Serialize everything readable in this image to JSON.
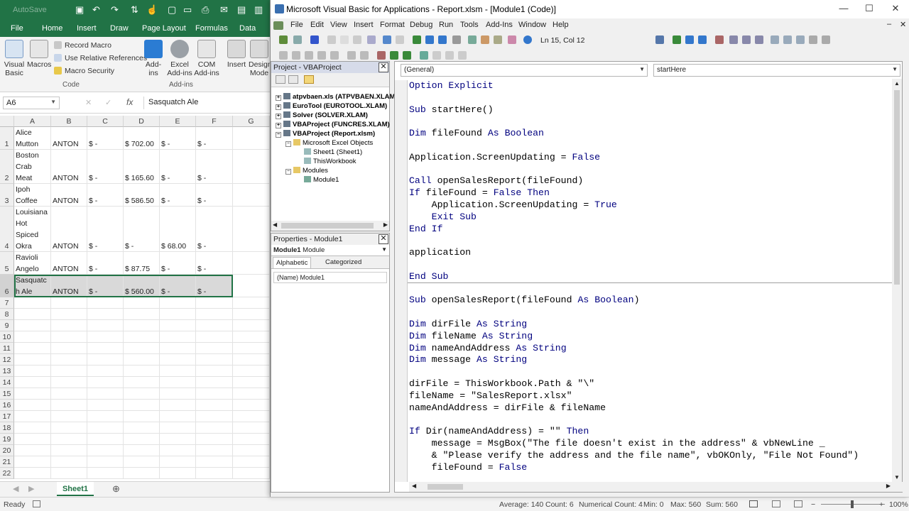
{
  "excel": {
    "autosave": "AutoSave",
    "tabs": [
      "File",
      "Home",
      "Insert",
      "Draw",
      "Page Layout",
      "Formulas",
      "Data"
    ],
    "ribbon": {
      "visual_basic": "Visual Basic",
      "macros": "Macros",
      "record_macro": "Record Macro",
      "relative_refs": "Use Relative References",
      "macro_security": "Macro Security",
      "group_code": "Code",
      "addins": "Add-ins",
      "excel_addins": "Excel Add-ins",
      "com_addins": "COM Add-ins",
      "group_addins": "Add-ins",
      "insert": "Insert",
      "design_mode": "Design Mode"
    },
    "name_box": "A6",
    "fx": "fx",
    "formula_value": "Sasquatch Ale",
    "columns": [
      "A",
      "B",
      "C",
      "D",
      "E",
      "F",
      "G"
    ],
    "rows": [
      {
        "n": "1",
        "a": [
          "Alice",
          "Mutton"
        ],
        "b": "ANTON",
        "c": "$      -",
        "d": "$ 702.00",
        "e": "$      -",
        "f": "$      -"
      },
      {
        "n": "2",
        "a": [
          "Boston",
          "Crab",
          "Meat"
        ],
        "b": "ANTON",
        "c": "$      -",
        "d": "$ 165.60",
        "e": "$      -",
        "f": "$      -"
      },
      {
        "n": "3",
        "a": [
          "Ipoh",
          "Coffee"
        ],
        "b": "ANTON",
        "c": "$      -",
        "d": "$ 586.50",
        "e": "$      -",
        "f": "$      -"
      },
      {
        "n": "4",
        "a": [
          "Louisiana",
          "Hot",
          "Spiced",
          "Okra"
        ],
        "b": "ANTON",
        "c": "$      -",
        "d": "$      -",
        "e": "$   68.00",
        "f": "$      -"
      },
      {
        "n": "5",
        "a": [
          "Ravioli",
          "Angelo"
        ],
        "b": "ANTON",
        "c": "$      -",
        "d": "$   87.75",
        "e": "$      -",
        "f": "$      -"
      },
      {
        "n": "6",
        "a": [
          "Sasquatc",
          "h Ale"
        ],
        "b": "ANTON",
        "c": "$      -",
        "d": "$ 560.00",
        "e": "$      -",
        "f": "$      -"
      }
    ],
    "empty_rows": [
      "7",
      "8",
      "9",
      "10",
      "11",
      "12",
      "13",
      "14",
      "15",
      "16",
      "17",
      "18",
      "19",
      "20",
      "21",
      "22"
    ],
    "sheet_tab": "Sheet1",
    "status": {
      "ready": "Ready",
      "average": "Average: 140",
      "count": "Count: 6",
      "numerical_count": "Numerical Count: 4",
      "min": "Min: 0",
      "max": "Max: 560",
      "sum": "Sum: 560",
      "zoom": "100%"
    }
  },
  "vbe": {
    "title": "Microsoft Visual Basic for Applications - Report.xlsm - [Module1 (Code)]",
    "menu": [
      "File",
      "Edit",
      "View",
      "Insert",
      "Format",
      "Debug",
      "Run",
      "Tools",
      "Add-Ins",
      "Window",
      "Help"
    ],
    "position": "Ln 15, Col 12",
    "project": {
      "title": "Project - VBAProject",
      "items": [
        "atpvbaen.xls (ATPVBAEN.XLAM)",
        "EuroTool (EUROTOOL.XLAM)",
        "Solver (SOLVER.XLAM)",
        "VBAProject (FUNCRES.XLAM)",
        "VBAProject (Report.xlsm)",
        "Microsoft Excel Objects",
        "Sheet1 (Sheet1)",
        "ThisWorkbook",
        "Modules",
        "Module1"
      ]
    },
    "properties": {
      "title": "Properties - Module1",
      "object": "Module1",
      "object_type": "Module",
      "tab_alpha": "Alphabetic",
      "tab_cat": "Categorized",
      "row_name": "(Name)",
      "row_value": "Module1"
    },
    "code": {
      "object_combo": "(General)",
      "proc_combo": "startHere",
      "lines": [
        "Option Explicit",
        "",
        "Sub startHere()",
        "",
        "Dim fileFound As Boolean",
        "",
        "Application.ScreenUpdating = False",
        "",
        "Call openSalesReport(fileFound)",
        "If fileFound = False Then",
        "    Application.ScreenUpdating = True",
        "    Exit Sub",
        "End If",
        "",
        "application",
        "",
        "End Sub",
        "",
        "Sub openSalesReport(fileFound As Boolean)",
        "",
        "Dim dirFile As String",
        "Dim fileName As String",
        "Dim nameAndAddress As String",
        "Dim message As String",
        "",
        "dirFile = ThisWorkbook.Path & \"\\\"",
        "fileName = \"SalesReport.xlsx\"",
        "nameAndAddress = dirFile & fileName",
        "",
        "If Dir(nameAndAddress) = \"\" Then",
        "    message = MsgBox(\"The file doesn't exist in the address\" & vbNewLine _",
        "    & \"Please verify the address and the file name\", vbOKOnly, \"File Not Found\")",
        "    fileFound = False"
      ]
    }
  },
  "colors": {
    "excel_green": "#217346",
    "vba_keyword": "#00007f"
  }
}
